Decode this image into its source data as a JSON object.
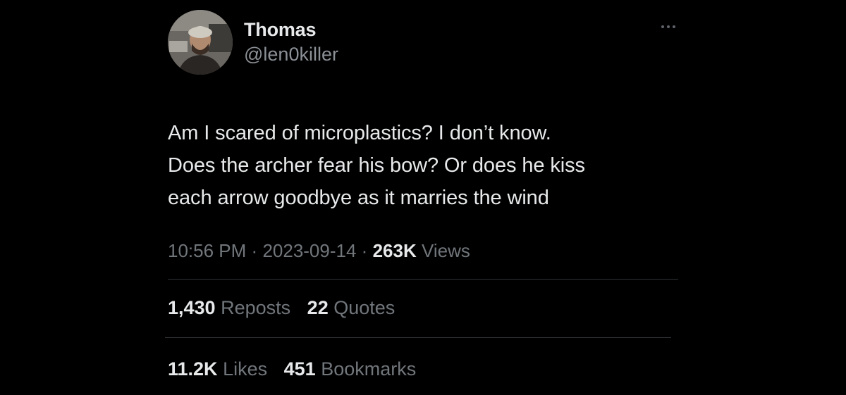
{
  "user": {
    "display_name": "Thomas",
    "handle": "@len0killer"
  },
  "post": {
    "lines": [
      "Am I scared of microplastics? I don’t know.",
      "Does the archer fear his bow? Or does he kiss",
      "each arrow goodbye as it marries the wind"
    ]
  },
  "meta": {
    "time": "10:56 PM",
    "sep1": "·",
    "date": "2023-09-14",
    "sep2": "·",
    "views_count": "263K",
    "views_label": "Views"
  },
  "stats": {
    "reposts_count": "1,430",
    "reposts_label": "Reposts",
    "quotes_count": "22",
    "quotes_label": "Quotes",
    "likes_count": "11.2K",
    "likes_label": "Likes",
    "bookmarks_count": "451",
    "bookmarks_label": "Bookmarks"
  },
  "icons": {
    "more": "more-horizontal-icon"
  },
  "colors": {
    "background": "#000000",
    "primary_text": "#e7e9ea",
    "secondary_text": "#71767b",
    "divider": "#2f3336"
  }
}
